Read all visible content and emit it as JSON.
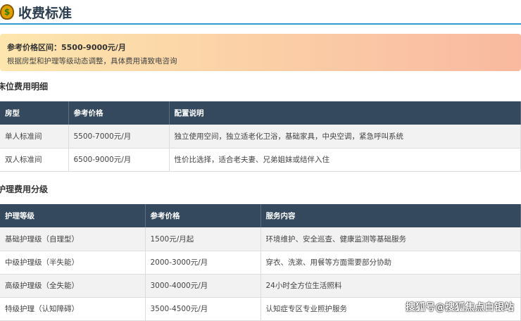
{
  "header": {
    "title": "收费标准",
    "icon": "money-bag-icon"
  },
  "banner": {
    "line1": "参考价格区间：5500-9000元/月",
    "line2": "根据房型和护理等级动态调整，具体费用请致电咨询"
  },
  "bed": {
    "heading": "床位费用明细",
    "columns": [
      "房型",
      "参考价格",
      "配置说明"
    ],
    "rows": [
      [
        "单人标准间",
        "5500-7000元/月",
        "独立使用空间，独立适老化卫浴，基础家具，中央空调，紧急呼叫系统"
      ],
      [
        "双人标准间",
        "6500-9000元/月",
        "性价比选择，适合老夫妻、兄弟姐妹或结伴入住"
      ]
    ]
  },
  "care": {
    "heading": "护理费用分级",
    "columns": [
      "护理等级",
      "参考价格",
      "服务内容"
    ],
    "rows": [
      [
        "基础护理级（自理型）",
        "1500元/月起",
        "环境维护、安全巡查、健康监测等基础服务"
      ],
      [
        "中级护理级（半失能）",
        "2000-3000元/月",
        "穿衣、洗漱、用餐等方面需要部分协助"
      ],
      [
        "高级护理级（全失能）",
        "3000-4000元/月",
        "24小时全方位生活照料"
      ],
      [
        "特级护理（认知障碍）",
        "3500-4500元/月",
        "认知症专区专业照护服务"
      ]
    ]
  },
  "watermark": "搜狐号@搜狐焦点白银站"
}
